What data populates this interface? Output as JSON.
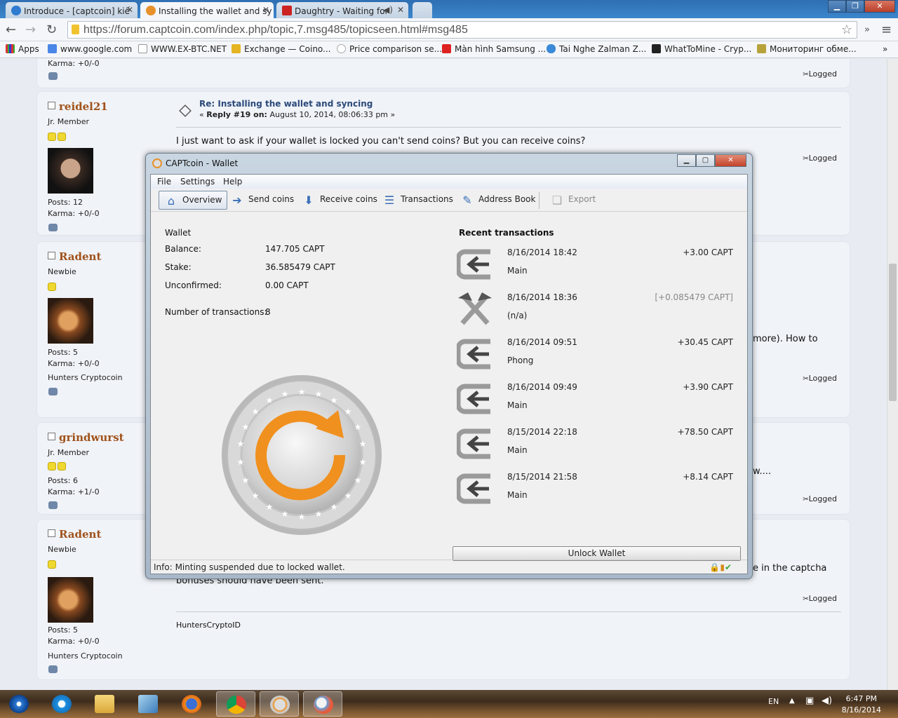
{
  "browser": {
    "tabs": [
      {
        "label": "Introduce - [captcoin] kiế",
        "color": "#2e7bd0"
      },
      {
        "label": "Installing the wallet and sy",
        "color": "#e8912a"
      },
      {
        "label": "Daughtry - Waiting for",
        "color": "#cc2222"
      }
    ],
    "url": "https://forum.captcoin.com/index.php/topic,7.msg485/topicseen.html#msg485",
    "bookmarks": [
      "Apps",
      "www.google.com",
      "WWW.EX-BTC.NET",
      "Exchange — Coino...",
      "Price comparison se...",
      "Màn hình Samsung ...",
      "Tai Nghe Zalman Z...",
      "WhatToMine - Cryp...",
      "Мониторинг обме..."
    ],
    "more": "»"
  },
  "forum": {
    "top_karma": "Karma: +0/-0",
    "top_logged": "Logged",
    "posts": [
      {
        "name": "reidel21",
        "rank": "Jr. Member",
        "stars": 2,
        "posts": "Posts: 12",
        "karma": "Karma: +0/-0",
        "subject": "Re: Installing the wallet and syncing",
        "meta_prefix": "« ",
        "reply": "Reply #19 on:",
        "date": "August 10, 2014, 08:06:33 pm",
        "meta_suffix": " »",
        "body": "I just want to ask if your wallet is locked you can't send coins? But you can receive coins?",
        "logged": "Logged"
      },
      {
        "name": "Radent",
        "rank": "Newbie",
        "stars": 1,
        "posts": "Posts: 5",
        "karma": "Karma: +0/-0",
        "extra": "Hunters Cryptocoin",
        "body_tail": "more). How to",
        "logged": "Logged"
      },
      {
        "name": "grindwurst",
        "rank": "Jr. Member",
        "stars": 2,
        "posts": "Posts: 6",
        "karma": "Karma: +1/-0",
        "body_tail": "w....",
        "logged": "Logged"
      },
      {
        "name": "Radent",
        "rank": "Newbie",
        "stars": 1,
        "posts": "Posts: 5",
        "karma": "Karma: +0/-0",
        "extra": "Hunters Cryptocoin",
        "body_tail": "e in the captcha",
        "body_line2": "bonuses should have been sent.",
        "signature": "HuntersCryptoID",
        "logged": "Logged"
      }
    ]
  },
  "wallet": {
    "title": "CAPTcoin - Wallet",
    "menu": [
      "File",
      "Settings",
      "Help"
    ],
    "toolbar": [
      "Overview",
      "Send coins",
      "Receive coins",
      "Transactions",
      "Address Book",
      "Export"
    ],
    "section": "Wallet",
    "balance_label": "Balance:",
    "balance": "147.705 CAPT",
    "stake_label": "Stake:",
    "stake": "36.585479 CAPT",
    "unconfirmed_label": "Unconfirmed:",
    "unconfirmed": "0.00 CAPT",
    "ntx_label": "Number of transactions:",
    "ntx": "8",
    "recent_title": "Recent transactions",
    "transactions": [
      {
        "date": "8/16/2014 18:42",
        "label": "Main",
        "amount": "+3.00 CAPT",
        "type": "receive"
      },
      {
        "date": "8/16/2014 18:36",
        "label": "(n/a)",
        "amount": "[+0.085479 CAPT]",
        "type": "mined"
      },
      {
        "date": "8/16/2014 09:51",
        "label": "Phong",
        "amount": "+30.45 CAPT",
        "type": "receive"
      },
      {
        "date": "8/16/2014 09:49",
        "label": "Main",
        "amount": "+3.90 CAPT",
        "type": "receive"
      },
      {
        "date": "8/15/2014 22:18",
        "label": "Main",
        "amount": "+78.50 CAPT",
        "type": "receive"
      },
      {
        "date": "8/15/2014 21:58",
        "label": "Main",
        "amount": "+8.14 CAPT",
        "type": "receive"
      }
    ],
    "unlock_button": "Unlock Wallet",
    "status": "Info: Minting suspended due to locked wallet."
  },
  "taskbar": {
    "lang": "EN",
    "time": "6:47 PM",
    "date": "8/16/2014"
  },
  "colors": {
    "accent_orange": "#f0901e",
    "username": "#a0521a",
    "titlebar": "#2f6fb3"
  }
}
